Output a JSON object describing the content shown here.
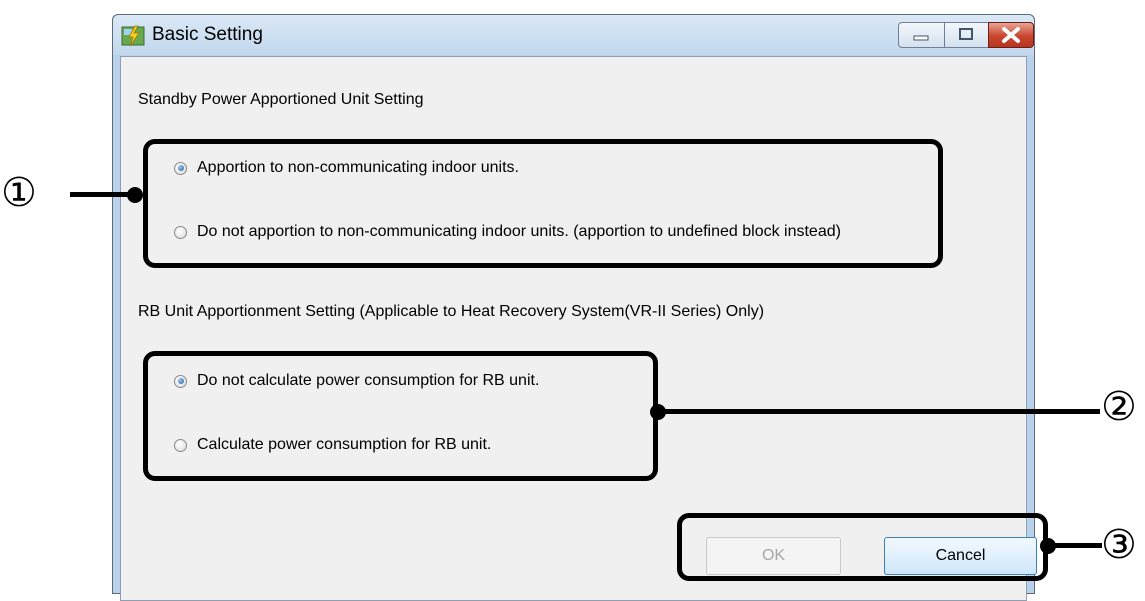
{
  "window": {
    "title": "Basic Setting",
    "controls": {
      "minimize": "minimize-icon",
      "maximize": "maximize-icon",
      "close": "close-icon"
    }
  },
  "section1": {
    "heading": "Standby Power Apportioned Unit Setting",
    "options": [
      {
        "label": "Apportion to non-communicating indoor units.",
        "selected": true
      },
      {
        "label": "Do not apportion to non-communicating indoor units. (apportion to undefined block instead)",
        "selected": false
      }
    ]
  },
  "section2": {
    "heading": "RB Unit Apportionment Setting (Applicable to Heat Recovery System(VR-II Series) Only)",
    "options": [
      {
        "label": "Do not calculate power consumption for RB unit.",
        "selected": true
      },
      {
        "label": "Calculate power consumption for RB unit.",
        "selected": false
      }
    ]
  },
  "buttons": {
    "ok": "OK",
    "cancel": "Cancel",
    "ok_enabled": false
  },
  "callouts": [
    "①",
    "②",
    "③"
  ],
  "colors": {
    "accent": "#1b5fa8",
    "titlebar": "#c2d8ee",
    "close": "#c8462f"
  }
}
